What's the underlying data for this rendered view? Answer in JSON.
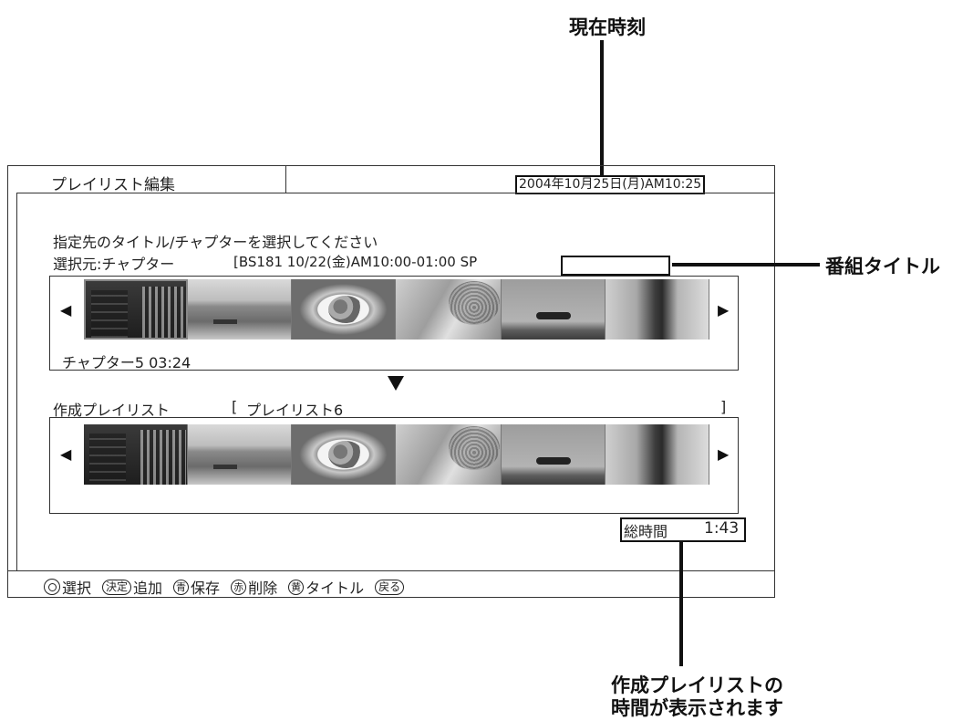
{
  "callouts": {
    "current_time": "現在時刻",
    "program_title": "番組タイトル",
    "playlist_time_line1": "作成プレイリストの",
    "playlist_time_line2": "時間が表示されます"
  },
  "screen": {
    "tab_title": "プレイリスト編集",
    "datetime": "2004年10月25日(月)AM10:25",
    "instruction": "指定先のタイトル/チャプターを選択してください",
    "source_label": "選択元:チャプター",
    "source_info": "[BS181  10/22(金)AM10:00-01:00 SP",
    "program_title_value": "",
    "chapter_info": "チャプター5 03:24",
    "playlist_label": "作成プレイリスト",
    "playlist_open_bracket": "[",
    "playlist_name": "プレイリスト6",
    "playlist_close_bracket": "]",
    "total_time_label": "総時間",
    "total_time_value": "1:43"
  },
  "strip_arrows": {
    "left": "◀",
    "right": "▶"
  },
  "source_thumbnails": [
    "city-night",
    "harbor",
    "food-plate",
    "people-hat",
    "airplane",
    "tree"
  ],
  "playlist_thumbnails": [
    "city-night",
    "harbor",
    "food-plate",
    "people-hat",
    "airplane",
    "tree"
  ],
  "footer": {
    "items": [
      {
        "icon": "dpad-icon",
        "label": "選択"
      },
      {
        "icon": "enter-key-icon",
        "key": "決定",
        "label": "追加"
      },
      {
        "icon": "blue-key-icon",
        "key": "青",
        "label": "保存"
      },
      {
        "icon": "red-key-icon",
        "key": "赤",
        "label": "削除"
      },
      {
        "icon": "yellow-key-icon",
        "key": "黄",
        "label": "タイトル"
      },
      {
        "icon": "back-key-icon",
        "key": "戻る",
        "label": ""
      }
    ]
  }
}
